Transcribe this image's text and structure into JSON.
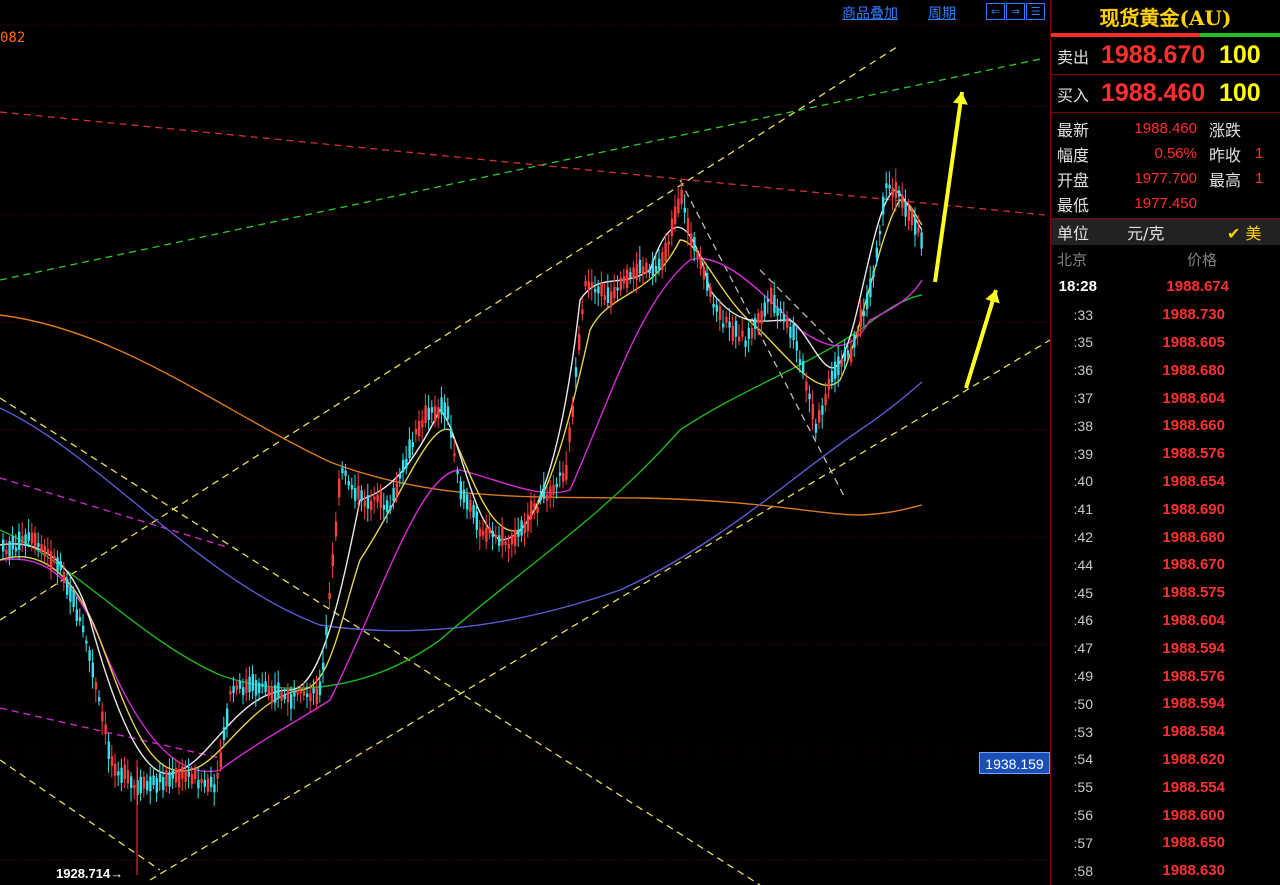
{
  "toolbar": {
    "overlay_label": "商品叠加",
    "period_label": "周期",
    "nav_icons": [
      "arrow-left-icon",
      "arrow-right-icon",
      "menu-icon"
    ]
  },
  "chart": {
    "corner_value": "082",
    "current_price_tag": "1938.159",
    "low_marker": "1928.714→",
    "colors": {
      "up_candle": "#ff3b3b",
      "down_candle": "#35e0f0",
      "ma_white": "#e8e8e8",
      "ma_yellow": "#e6d24a",
      "ma_magenta": "#d62ad6",
      "ma_green": "#1fb51f",
      "ma_blue": "#5a5ad0",
      "ma_orange": "#d97a1c",
      "trend_yellow": "#e6e05a",
      "trend_green": "#2ec82e",
      "trend_red": "#d03030",
      "arrow": "#ffff20"
    }
  },
  "quote": {
    "title": "现货黄金(AU)",
    "sell_label": "卖出",
    "sell_price": "1988.670",
    "sell_vol": "100",
    "buy_label": "买入",
    "buy_price": "1988.460",
    "buy_vol": "100",
    "stats": [
      {
        "k": "最新",
        "v": "1988.460",
        "k2": "涨跌",
        "v2": ""
      },
      {
        "k": "幅度",
        "v": "0.56%",
        "k2": "昨收",
        "v2": "1"
      },
      {
        "k": "开盘",
        "v": "1977.700",
        "k2": "最高",
        "v2": "1"
      },
      {
        "k": "最低",
        "v": "1977.450",
        "k2": "",
        "v2": ""
      }
    ],
    "unit_label": "单位",
    "unit_value": "元/克",
    "unit_check": "✔ 美",
    "tick_header_time": "北京",
    "tick_header_price": "价格",
    "ticks": [
      {
        "t": "18:28",
        "p": "1988.674"
      },
      {
        "t": ":33",
        "p": "1988.730"
      },
      {
        "t": ":35",
        "p": "1988.605"
      },
      {
        "t": ":36",
        "p": "1988.680"
      },
      {
        "t": ":37",
        "p": "1988.604"
      },
      {
        "t": ":38",
        "p": "1988.660"
      },
      {
        "t": ":39",
        "p": "1988.576"
      },
      {
        "t": ":40",
        "p": "1988.654"
      },
      {
        "t": ":41",
        "p": "1988.690"
      },
      {
        "t": ":42",
        "p": "1988.680"
      },
      {
        "t": ":44",
        "p": "1988.670"
      },
      {
        "t": ":45",
        "p": "1988.575"
      },
      {
        "t": ":46",
        "p": "1988.604"
      },
      {
        "t": ":47",
        "p": "1988.594"
      },
      {
        "t": ":49",
        "p": "1988.576"
      },
      {
        "t": ":50",
        "p": "1988.594"
      },
      {
        "t": ":53",
        "p": "1988.584"
      },
      {
        "t": ":54",
        "p": "1988.620"
      },
      {
        "t": ":55",
        "p": "1988.554"
      },
      {
        "t": ":56",
        "p": "1988.600"
      },
      {
        "t": ":57",
        "p": "1988.650"
      },
      {
        "t": ":58",
        "p": "1988.630"
      }
    ]
  }
}
